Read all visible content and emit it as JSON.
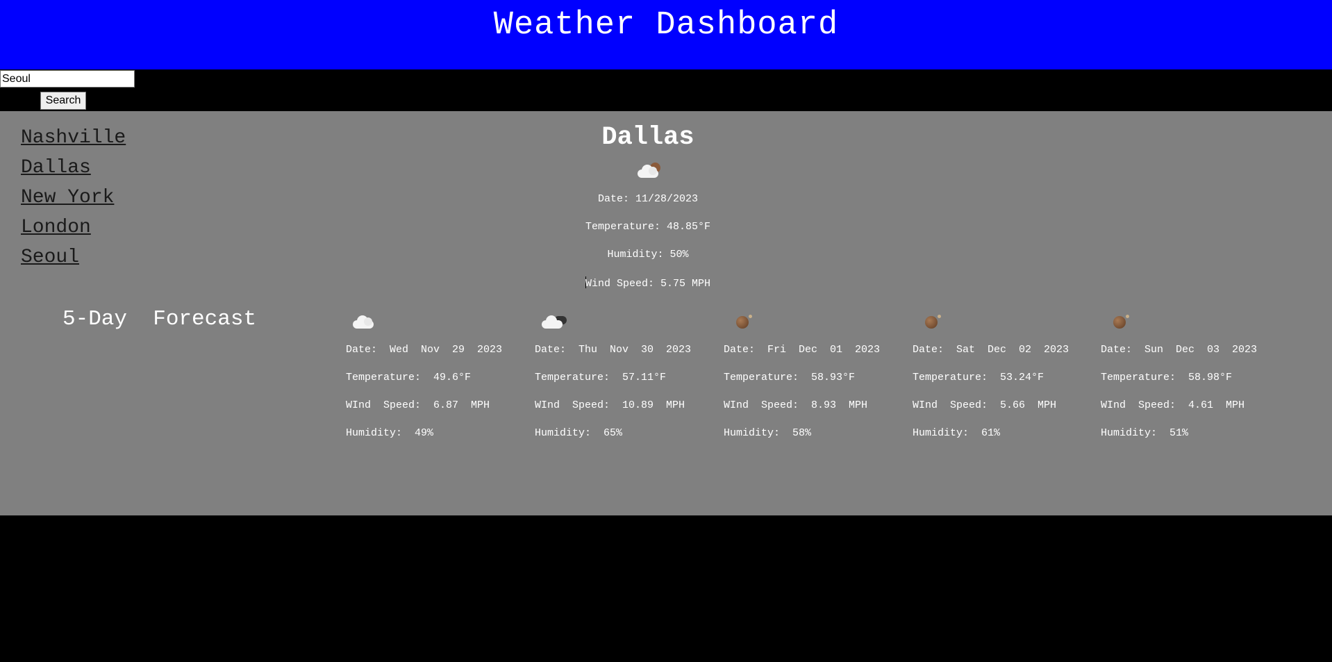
{
  "header": {
    "title": "Weather Dashboard"
  },
  "search": {
    "value": "Seoul",
    "button_label": "Search"
  },
  "sidebar": {
    "cities": [
      "Nashville",
      "Dallas",
      "New York",
      "London",
      "Seoul"
    ]
  },
  "current": {
    "city": "Dallas",
    "icon": "partly-cloudy-night-icon",
    "date": "Date: 11/28/2023",
    "temperature": "Temperature: 48.85°F",
    "humidity": "Humidity: 50%",
    "wind_speed": "Wind Speed: 5.75 MPH"
  },
  "forecast": {
    "title": "5-Day  Forecast",
    "days": [
      {
        "icon": "cloud-icon",
        "date": "Date:  Wed  Nov  29  2023",
        "temperature": "Temperature:  49.6°F",
        "wind": "WInd  Speed:  6.87  MPH",
        "humidity": "Humidity:  49%"
      },
      {
        "icon": "cloudy-night-icon",
        "date": "Date:  Thu  Nov  30  2023",
        "temperature": "Temperature:  57.11°F",
        "wind": "WInd  Speed:  10.89  MPH",
        "humidity": "Humidity:  65%"
      },
      {
        "icon": "clear-night-icon",
        "date": "Date:  Fri  Dec  01  2023",
        "temperature": "Temperature:  58.93°F",
        "wind": "WInd  Speed:  8.93  MPH",
        "humidity": "Humidity:  58%"
      },
      {
        "icon": "clear-night-icon",
        "date": "Date:  Sat  Dec  02  2023",
        "temperature": "Temperature:  53.24°F",
        "wind": "WInd  Speed:  5.66  MPH",
        "humidity": "Humidity:  61%"
      },
      {
        "icon": "clear-night-icon",
        "date": "Date:  Sun  Dec  03  2023",
        "temperature": "Temperature:  58.98°F",
        "wind": "WInd  Speed:  4.61  MPH",
        "humidity": "Humidity:  51%"
      }
    ]
  },
  "colors": {
    "header_bg": "#0000ff",
    "main_bg": "#808080",
    "page_bg": "#000000",
    "link_color": "#1a1a1a"
  }
}
